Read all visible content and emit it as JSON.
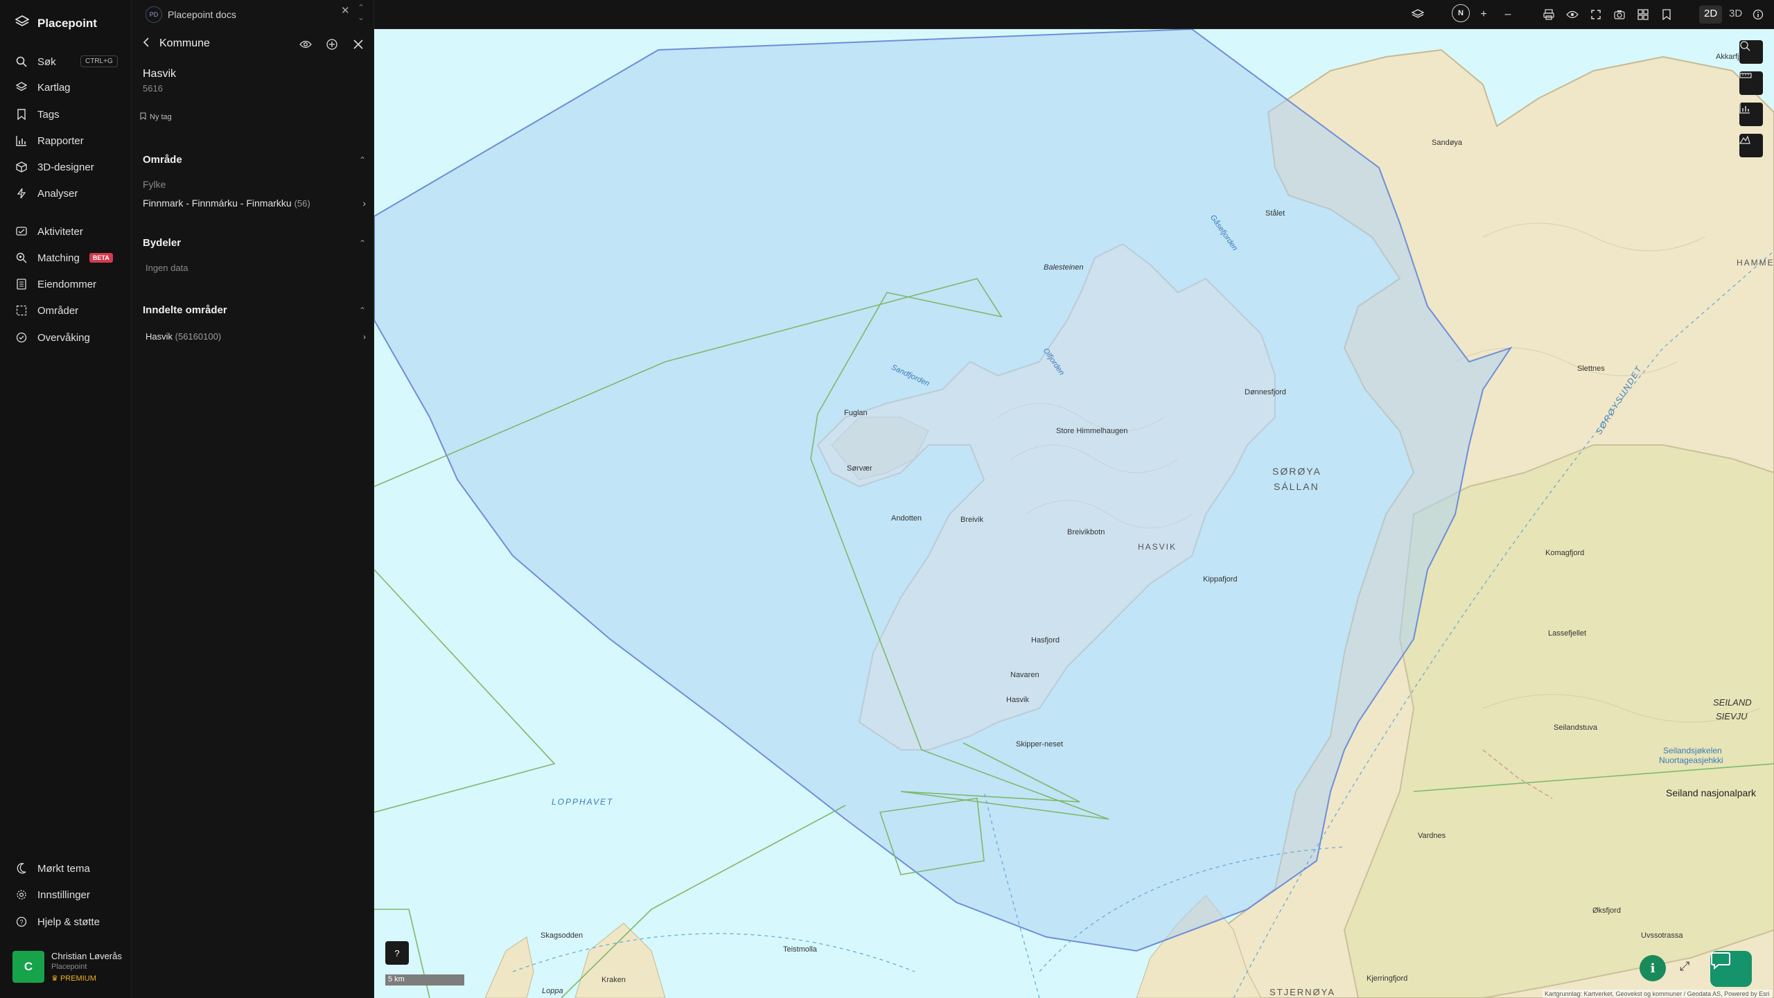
{
  "app": {
    "name": "Placepoint"
  },
  "nav": {
    "search": {
      "label": "Søk",
      "shortcut": "CTRL+G"
    },
    "items_top": [
      {
        "label": "Kartlag",
        "icon": "layers-icon"
      },
      {
        "label": "Tags",
        "icon": "bookmark-icon"
      },
      {
        "label": "Rapporter",
        "icon": "bar-chart-icon"
      },
      {
        "label": "3D-designer",
        "icon": "cube-icon"
      },
      {
        "label": "Analyser",
        "icon": "bolt-icon"
      }
    ],
    "items_mid": [
      {
        "label": "Aktiviteter",
        "icon": "activity-icon"
      },
      {
        "label": "Matching",
        "icon": "matching-icon",
        "badge": "BETA"
      },
      {
        "label": "Eiendommer",
        "icon": "property-icon"
      },
      {
        "label": "Områder",
        "icon": "area-icon"
      },
      {
        "label": "Overvåking",
        "icon": "monitor-icon"
      }
    ],
    "items_bottom": [
      {
        "label": "Mørkt tema",
        "icon": "moon-icon"
      },
      {
        "label": "Innstillinger",
        "icon": "gear-icon"
      },
      {
        "label": "Hjelp & støtte",
        "icon": "help-icon"
      }
    ],
    "user": {
      "initial": "C",
      "name": "Christian Løverås",
      "org": "Placepoint",
      "plan": "PREMIUM"
    }
  },
  "doc": {
    "badge": "PD",
    "title": "Placepoint docs"
  },
  "panel": {
    "title": "Kommune",
    "place": {
      "name": "Hasvik",
      "code": "5616"
    },
    "new_tag": "Ny tag",
    "sections": {
      "area": {
        "title": "Område",
        "sub": "Fylke",
        "value": "Finnmark - Finnmárku - Finmarkku",
        "count": "(56)"
      },
      "districts": {
        "title": "Bydeler",
        "empty": "Ingen data"
      },
      "subdivided": {
        "title": "Inndelte områder",
        "item": "Hasvik",
        "item_count": "(56160100)"
      }
    }
  },
  "toolbar": {
    "compass": "N",
    "mode_2d": "2D",
    "mode_3d": "3D"
  },
  "map": {
    "scale": "5 km",
    "attribution": "Kartgrunnlag: Kartverket, Geovekst og kommuner / Geodata AS, Powered by Esri",
    "labels": {
      "lopphavet": "LOPPHAVET",
      "soroya": "SØRØYA",
      "sallan": "SÁLLAN",
      "hasvik_region": "HASVIK",
      "sorosundet": "SØRØYSUNDET",
      "seiland": "SEILAND",
      "sievju": "SIEVJU",
      "stjernoya": "STJERNØYA",
      "hammerfest": "HAMMEF",
      "hasvik": "Hasvik",
      "breivikbotn": "Breivikbotn",
      "sorvaer": "Sørvær",
      "breivik": "Breivik",
      "kippatjord": "Kippafjord",
      "hasfjord": "Hasfjord",
      "donnesfjord": "Dønnesfjord",
      "seiland_park": "Seiland nasjonalpark",
      "seilandsjokelen": "Seilandsjøkelen",
      "nuortagasjehkki": "Nuortageasjehkki",
      "slettnes": "Slettnes",
      "vardnes": "Vardnes",
      "kjerringfjord": "Kjerringfjord",
      "skipperneset": "Skipper-neset",
      "navaren": "Navaren",
      "balesteinen": "Balesteinen",
      "sandfjorden": "Sandfjorden",
      "olfjorden": "Olfjorden",
      "gaselfjorden": "Gåsefjorden",
      "sandoya": "Sandøya",
      "store_himmelhaugen": "Store Himmelhaugen",
      "fuglan": "Fuglan",
      "andotten": "Andotten",
      "skagsodden": "Skagsodden",
      "teistmolla": "Teistmolla",
      "kraken": "Kraken",
      "loppa": "Loppa",
      "akkarfjord": "Akkarfjord",
      "staalet": "Stålet",
      "komagfjord": "Komagfjord",
      "lasenfjellet": "Lassefjellet",
      "seilandstuva": "Seilandstuva",
      "uvssotrassa": "Uvssotrassa",
      "oksfjord": "Øksfjord"
    }
  }
}
